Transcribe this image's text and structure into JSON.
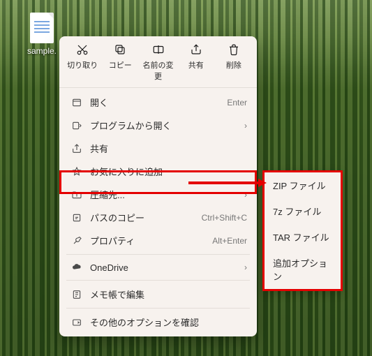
{
  "desktop": {
    "file_label": "sample."
  },
  "toolbar": {
    "cut": "切り取り",
    "copy": "コピー",
    "rename": "名前の変更",
    "share": "共有",
    "delete": "削除"
  },
  "menu": {
    "open": {
      "label": "開く",
      "accel": "Enter"
    },
    "open_with": {
      "label": "プログラムから開く"
    },
    "share": {
      "label": "共有"
    },
    "favorites": {
      "label": "お気に入りに追加"
    },
    "compress": {
      "label": "圧縮先..."
    },
    "copy_path": {
      "label": "パスのコピー",
      "accel": "Ctrl+Shift+C"
    },
    "properties": {
      "label": "プロパティ",
      "accel": "Alt+Enter"
    },
    "onedrive": {
      "label": "OneDrive"
    },
    "notepad": {
      "label": "メモ帳で編集"
    },
    "more": {
      "label": "その他のオプションを確認"
    }
  },
  "submenu": {
    "items": [
      "ZIP ファイル",
      "7z ファイル",
      "TAR ファイル",
      "追加オプション"
    ]
  },
  "highlight": {
    "color": "#e40000"
  }
}
